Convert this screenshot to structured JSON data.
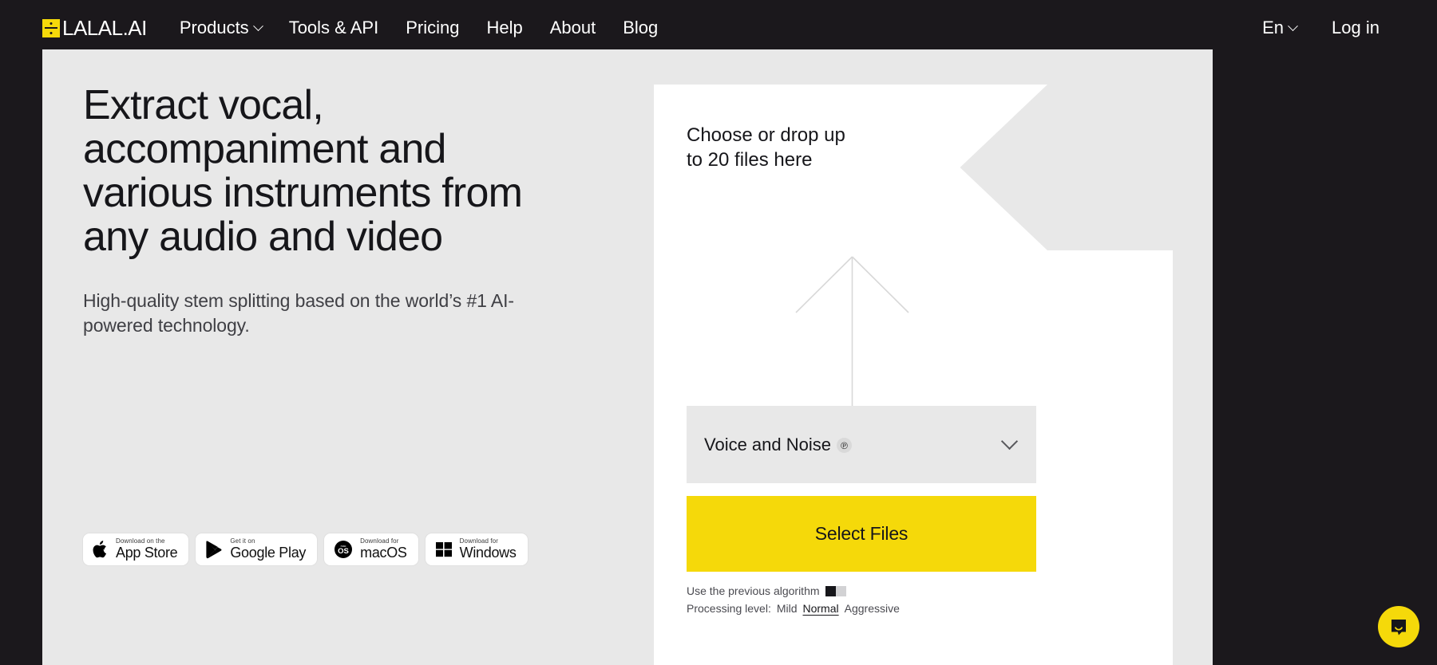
{
  "header": {
    "logo_text": "LALAL.AI",
    "logo_icon": "division-square-icon",
    "nav": [
      {
        "label": "Products",
        "has_chevron": true
      },
      {
        "label": "Tools & API",
        "has_chevron": false
      },
      {
        "label": "Pricing",
        "has_chevron": false
      },
      {
        "label": "Help",
        "has_chevron": false
      },
      {
        "label": "About",
        "has_chevron": false
      },
      {
        "label": "Blog",
        "has_chevron": false
      }
    ],
    "language": "En",
    "login": "Log in"
  },
  "hero": {
    "headline": "Extract vocal, accompaniment and various instruments from any audio and video",
    "subheadline": "High-quality stem splitting based on the world’s #1 AI-powered technology."
  },
  "stores": [
    {
      "top": "Download on the",
      "main": "App Store",
      "icon": "apple-icon"
    },
    {
      "top": "Get it on",
      "main": "Google Play",
      "icon": "google-play-icon"
    },
    {
      "top": "Download for",
      "main": "macOS",
      "icon": "macos-icon"
    },
    {
      "top": "Download for",
      "main": "Windows",
      "icon": "windows-icon"
    }
  ],
  "upload": {
    "title": "Choose or drop up to 20 files here",
    "arrow_icon": "upload-arrow-icon",
    "preset": {
      "value": "Voice and Noise",
      "badge": "℗",
      "chevron_icon": "chevron-down-icon"
    },
    "select_files_label": "Select Files",
    "previous_algorithm_label": "Use the previous algorithm",
    "previous_algorithm_enabled": false,
    "processing_level_label": "Processing level:",
    "processing_levels": [
      "Mild",
      "Normal",
      "Aggressive"
    ],
    "processing_level_selected": "Normal"
  },
  "chat": {
    "icon": "chat-bubble-icon"
  },
  "colors": {
    "brand_yellow": "#f5d90a",
    "dark": "#1b181c",
    "panel": "#e8e8e8",
    "card": "#ffffff"
  }
}
